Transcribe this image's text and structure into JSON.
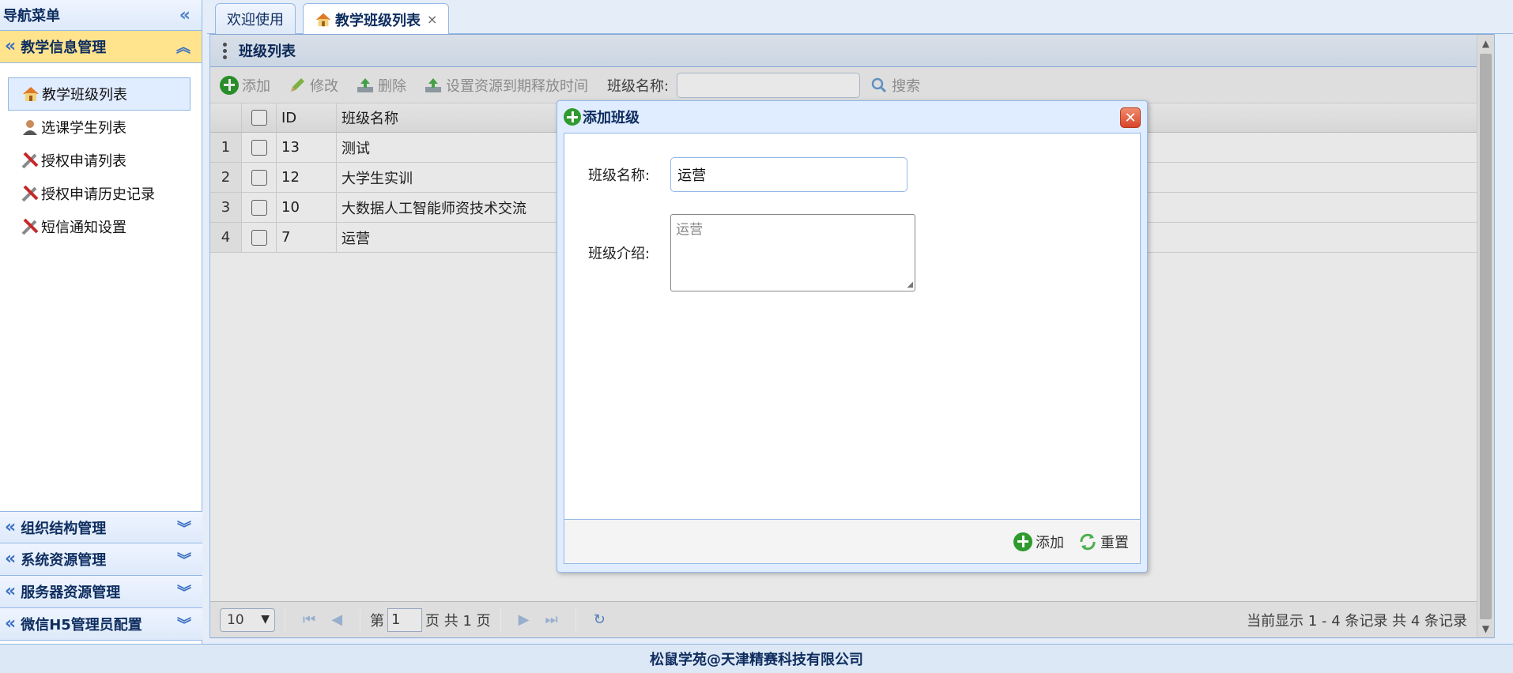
{
  "nav": {
    "title": "导航菜单",
    "sections": [
      {
        "label": "教学信息管理",
        "active": true
      },
      {
        "label": "组织结构管理"
      },
      {
        "label": "系统资源管理"
      },
      {
        "label": "服务器资源管理"
      },
      {
        "label": "微信H5管理员配置"
      }
    ],
    "items": [
      {
        "label": "教学班级列表",
        "icon": "home-icon",
        "selected": true
      },
      {
        "label": "选课学生列表",
        "icon": "user-icon"
      },
      {
        "label": "授权申请列表",
        "icon": "tools-icon"
      },
      {
        "label": "授权申请历史记录",
        "icon": "tools-icon"
      },
      {
        "label": "短信通知设置",
        "icon": "tools-icon"
      }
    ]
  },
  "tabs": [
    {
      "label": "欢迎使用"
    },
    {
      "label": "教学班级列表",
      "close": "×"
    }
  ],
  "panel": {
    "title": "班级列表",
    "toolbar": {
      "add": "添加",
      "edit": "修改",
      "delete": "删除",
      "set_resource": "设置资源到期释放时间",
      "search_label": "班级名称:",
      "search_btn": "搜索"
    },
    "grid": {
      "columns": [
        "ID",
        "班级名称"
      ],
      "rows": [
        {
          "rn": "1",
          "id": "13",
          "name": "测试"
        },
        {
          "rn": "2",
          "id": "12",
          "name": "大学生实训"
        },
        {
          "rn": "3",
          "id": "10",
          "name": "大数据人工智能师资技术交流"
        },
        {
          "rn": "4",
          "id": "7",
          "name": "运营"
        }
      ]
    },
    "pager": {
      "page_size": "10",
      "page_prefix": "第",
      "page_value": "1",
      "page_suffix": "页 共 1 页",
      "info": "当前显示 1 - 4 条记录 共 4 条记录"
    }
  },
  "dialog": {
    "title": "添加班级",
    "name_label": "班级名称:",
    "name_value": "运营",
    "intro_label": "班级介绍:",
    "intro_value": "运营",
    "add_btn": "添加",
    "reset_btn": "重置"
  },
  "footer": "松鼠学苑@天津精赛科技有限公司",
  "colors": {
    "accent": "#95b8e7",
    "active_section": "#ffe48d",
    "title_text": "#0e2d5f"
  }
}
